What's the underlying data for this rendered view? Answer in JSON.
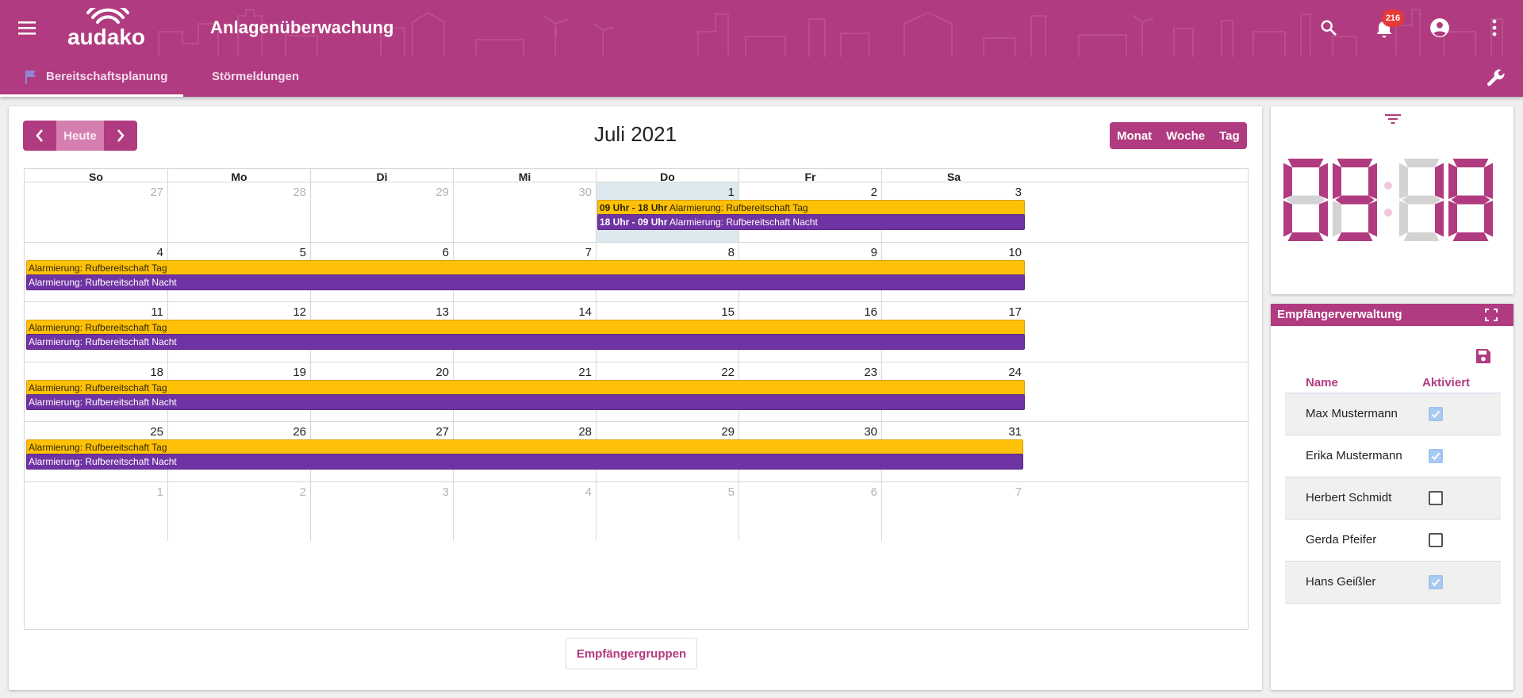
{
  "header": {
    "app_title": "Anlagenüberwachung",
    "logo_text": "audako",
    "notification_count": "216",
    "icons": [
      "menu-icon",
      "search-icon",
      "bell-icon",
      "account-icon",
      "more-vert-icon"
    ]
  },
  "tabs": [
    {
      "label": "Bereitschaftsplanung",
      "active": true,
      "icon": "flag-icon"
    },
    {
      "label": "Störmeldungen",
      "active": false
    }
  ],
  "toolbar_icon": "wrench-icon",
  "calendar": {
    "title": "Juli 2021",
    "nav": {
      "prev_icon": "chevron-left-icon",
      "today_label": "Heute",
      "next_icon": "chevron-right-icon"
    },
    "views": [
      "Monat",
      "Woche",
      "Tag"
    ],
    "weekdays": [
      "So",
      "Mo",
      "Di",
      "Mi",
      "Do",
      "Fr",
      "Sa"
    ],
    "weeks": [
      {
        "days": [
          {
            "n": "27",
            "other": true
          },
          {
            "n": "28",
            "other": true
          },
          {
            "n": "29",
            "other": true
          },
          {
            "n": "30",
            "other": true
          },
          {
            "n": "1",
            "today": true
          },
          {
            "n": "2"
          },
          {
            "n": "3"
          }
        ],
        "events": [
          {
            "kind": "day",
            "start": 4,
            "end": 7,
            "time": "09 Uhr - 18 Uhr",
            "label": "Alarmierung: Rufbereitschaft Tag"
          },
          {
            "kind": "night",
            "start": 4,
            "end": 7,
            "time": "18 Uhr - 09 Uhr",
            "label": "Alarmierung: Rufbereitschaft Nacht"
          }
        ]
      },
      {
        "days": [
          {
            "n": "4"
          },
          {
            "n": "5"
          },
          {
            "n": "6"
          },
          {
            "n": "7"
          },
          {
            "n": "8"
          },
          {
            "n": "9"
          },
          {
            "n": "10"
          }
        ],
        "events": [
          {
            "kind": "day",
            "start": 0,
            "end": 7,
            "time": "",
            "label": "Alarmierung: Rufbereitschaft Tag"
          },
          {
            "kind": "night",
            "start": 0,
            "end": 7,
            "time": "",
            "label": "Alarmierung: Rufbereitschaft Nacht"
          }
        ]
      },
      {
        "days": [
          {
            "n": "11"
          },
          {
            "n": "12"
          },
          {
            "n": "13"
          },
          {
            "n": "14"
          },
          {
            "n": "15"
          },
          {
            "n": "16"
          },
          {
            "n": "17"
          }
        ],
        "events": [
          {
            "kind": "day",
            "start": 0,
            "end": 7,
            "time": "",
            "label": "Alarmierung: Rufbereitschaft Tag"
          },
          {
            "kind": "night",
            "start": 0,
            "end": 7,
            "time": "",
            "label": "Alarmierung: Rufbereitschaft Nacht"
          }
        ]
      },
      {
        "days": [
          {
            "n": "18"
          },
          {
            "n": "19"
          },
          {
            "n": "20"
          },
          {
            "n": "21"
          },
          {
            "n": "22"
          },
          {
            "n": "23"
          },
          {
            "n": "24"
          }
        ],
        "events": [
          {
            "kind": "day",
            "start": 0,
            "end": 7,
            "time": "",
            "label": "Alarmierung: Rufbereitschaft Tag"
          },
          {
            "kind": "night",
            "start": 0,
            "end": 7,
            "time": "",
            "label": "Alarmierung: Rufbereitschaft Nacht"
          }
        ]
      },
      {
        "days": [
          {
            "n": "25"
          },
          {
            "n": "26"
          },
          {
            "n": "27"
          },
          {
            "n": "28"
          },
          {
            "n": "29"
          },
          {
            "n": "30"
          },
          {
            "n": "31"
          }
        ],
        "events": [
          {
            "kind": "day",
            "start": 0,
            "end": 7,
            "time": "",
            "label": "Alarmierung: Rufbereitschaft Tag"
          },
          {
            "kind": "night",
            "start": 0,
            "end": 7,
            "time": "",
            "label": "Alarmierung: Rufbereitschaft Nacht"
          }
        ]
      },
      {
        "days": [
          {
            "n": "1",
            "other": true
          },
          {
            "n": "2",
            "other": true
          },
          {
            "n": "3",
            "other": true
          },
          {
            "n": "4",
            "other": true
          },
          {
            "n": "5",
            "other": true
          },
          {
            "n": "6",
            "other": true
          },
          {
            "n": "7",
            "other": true
          }
        ],
        "events": []
      }
    ],
    "groups_button": "Empfängergruppen"
  },
  "clock": {
    "time": "09:18",
    "filter_icon": "filter-icon"
  },
  "recipients": {
    "title": "Empfängerverwaltung",
    "fullscreen_icon": "fullscreen-icon",
    "save_icon": "save-icon",
    "columns": {
      "name": "Name",
      "active": "Aktiviert"
    },
    "rows": [
      {
        "name": "Max Mustermann",
        "active": true
      },
      {
        "name": "Erika Mustermann",
        "active": true
      },
      {
        "name": "Herbert Schmidt",
        "active": false
      },
      {
        "name": "Gerda Pfeifer",
        "active": false
      },
      {
        "name": "Hans Geißler",
        "active": true
      }
    ]
  },
  "colors": {
    "brand": "#b13b80",
    "event_day": "#ffc107",
    "event_night": "#7033a3",
    "today": "#dde9ee",
    "checkbox_on": "#a8cbf2",
    "clock_on": "#b13b80",
    "clock_off": "#d3d3d3"
  }
}
